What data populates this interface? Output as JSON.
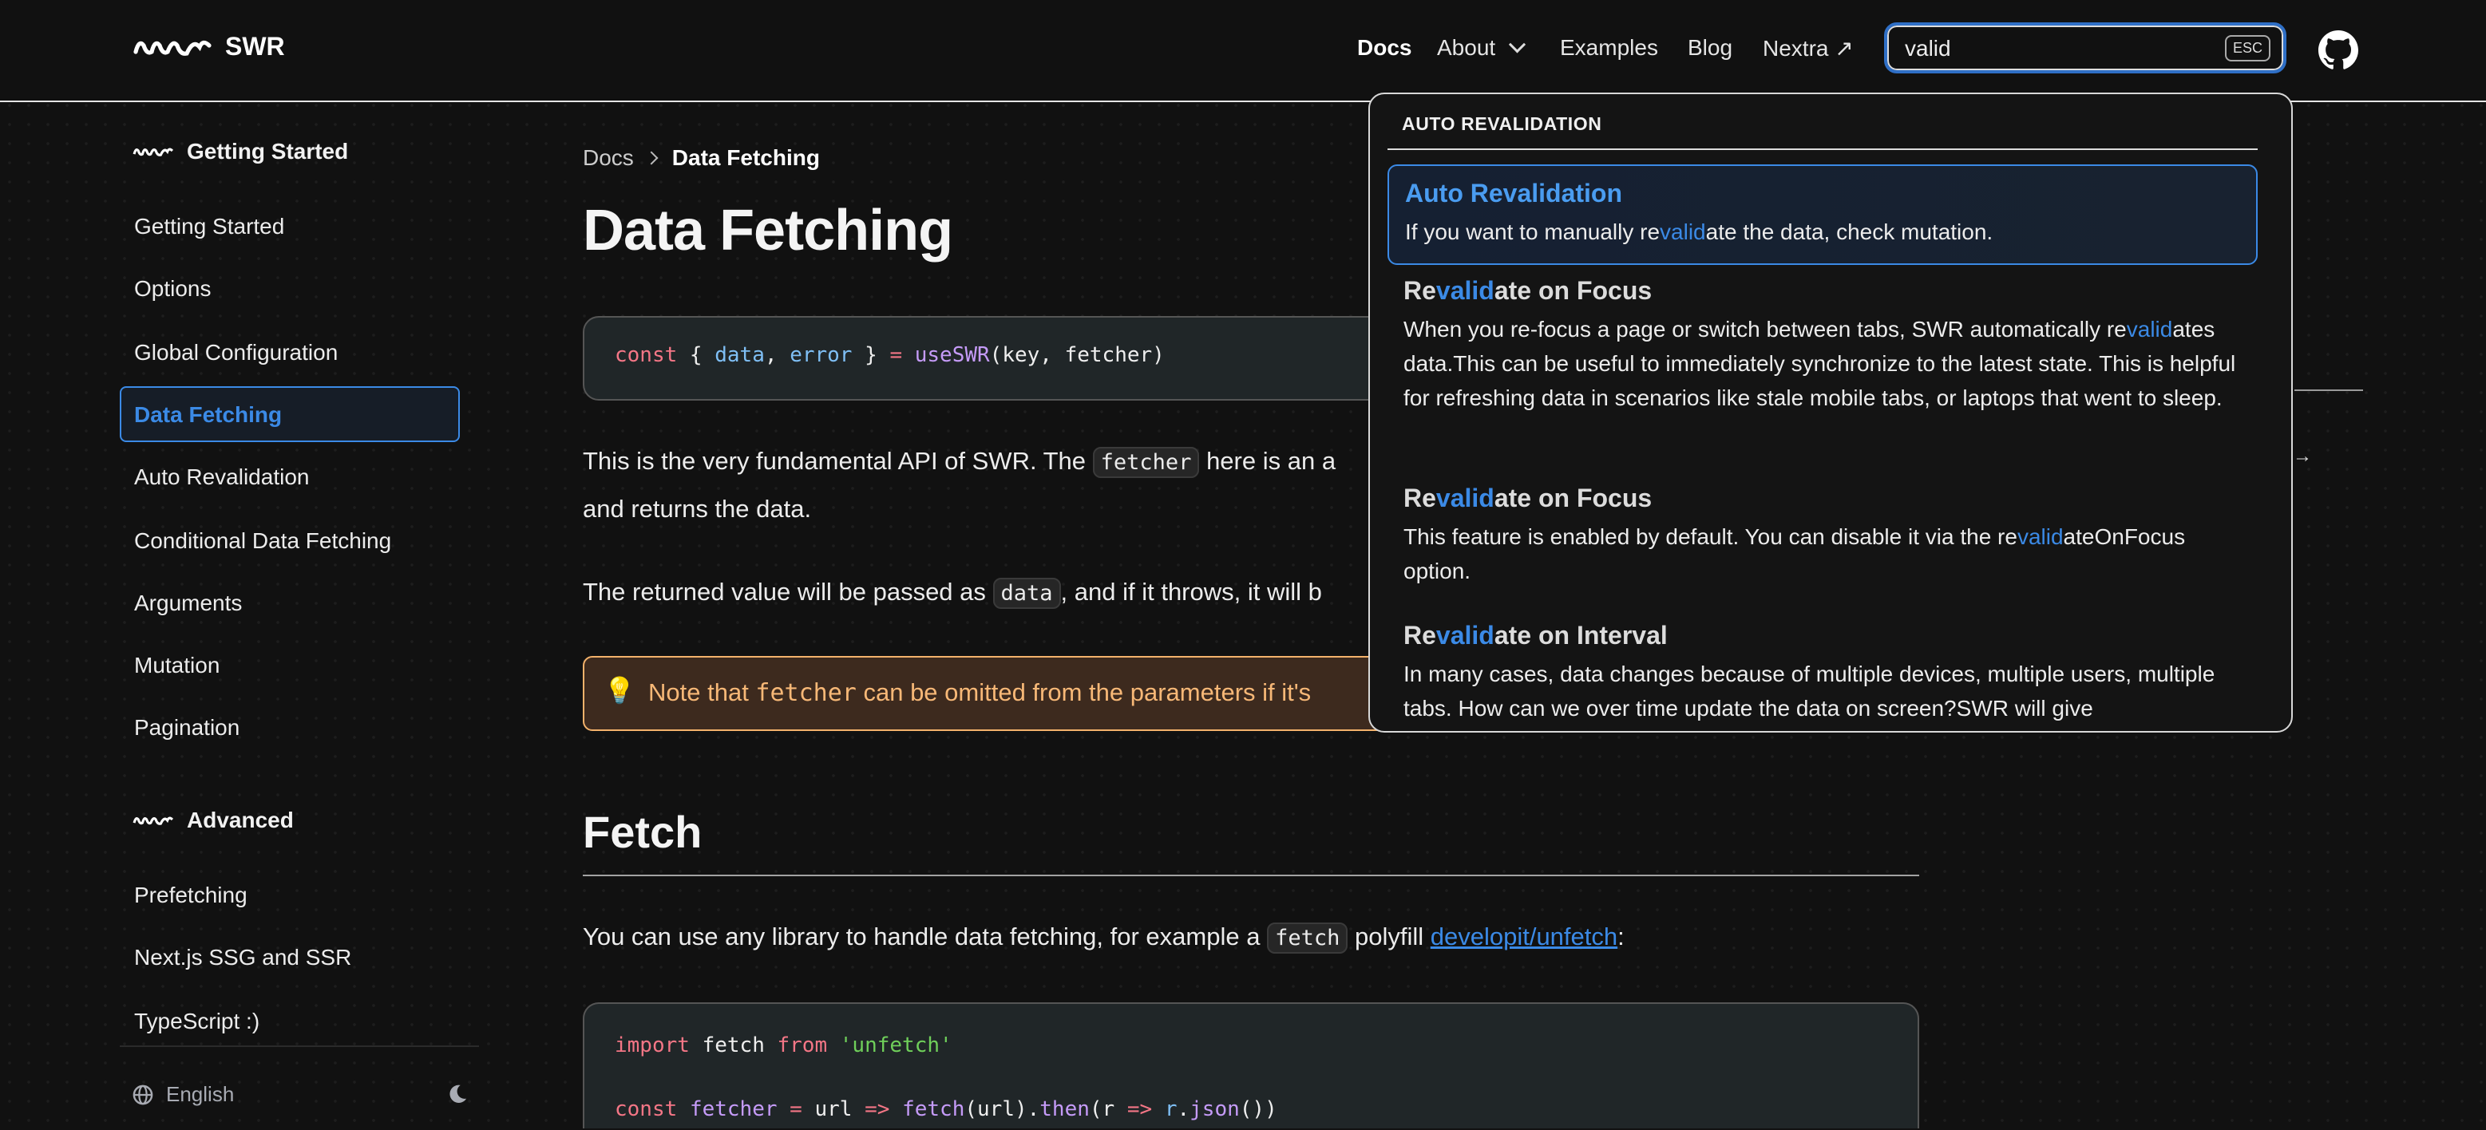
{
  "header": {
    "brand": "SWR",
    "nav": [
      {
        "label": "Docs",
        "active": true
      },
      {
        "label": "About",
        "has_dropdown": true
      },
      {
        "label": "Examples"
      },
      {
        "label": "Blog"
      },
      {
        "label": "Nextra ↗"
      }
    ],
    "search": {
      "value": "valid",
      "esc_label": "ESC",
      "focus_color": "#2f6fc6"
    }
  },
  "sidebar": {
    "sections": [
      {
        "title": "Getting Started",
        "items": [
          "Getting Started",
          "Options",
          "Global Configuration",
          "Data Fetching",
          "Auto Revalidation",
          "Conditional Data Fetching",
          "Arguments",
          "Mutation",
          "Pagination"
        ],
        "active": "Data Fetching"
      },
      {
        "title": "Advanced",
        "items": [
          "Prefetching",
          "Next.js SSG and SSR",
          "TypeScript :)"
        ]
      }
    ],
    "footer": {
      "language": "English",
      "theme_icon": "moon-icon"
    }
  },
  "main": {
    "breadcrumb": [
      "Docs",
      "Data Fetching"
    ],
    "title": "Data Fetching",
    "code1": [
      [
        "kw",
        "const"
      ],
      [
        "pl",
        " { "
      ],
      [
        "vr",
        "data"
      ],
      [
        "pl",
        ", "
      ],
      [
        "vr",
        "error"
      ],
      [
        "pl",
        " } "
      ],
      [
        "kw",
        "="
      ],
      [
        "pl",
        " "
      ],
      [
        "fn",
        "useSWR"
      ],
      [
        "pl",
        "(key, fetcher)"
      ]
    ],
    "para1": {
      "a": "This is the very fundamental API of SWR. The ",
      "code": "fetcher",
      "b": " here is an a",
      "line2": "and returns the data."
    },
    "para2": {
      "a": "The returned value will be passed as ",
      "code": "data",
      "b": ", and if it throws, it will b"
    },
    "callout": {
      "icon": "💡",
      "a": "Note that ",
      "code": "fetcher",
      "b": " can be omitted from the parameters if it's",
      "color": "#f7b877"
    },
    "h2": "Fetch",
    "para3": {
      "a": "You can use any library to handle data fetching, for example a ",
      "code": "fetch",
      "b": " polyfill ",
      "link": "developit/unfetch",
      "c": ":"
    },
    "code2": [
      [
        [
          "kw",
          "import"
        ],
        [
          "pl",
          " fetch "
        ],
        [
          "kw",
          "from"
        ],
        [
          "pl",
          " "
        ],
        [
          "st",
          "'unfetch'"
        ]
      ],
      [
        [
          "kw",
          "const"
        ],
        [
          "pl",
          " "
        ],
        [
          "fn",
          "fetcher"
        ],
        [
          "pl",
          " "
        ],
        [
          "kw",
          "="
        ],
        [
          "pl",
          " url "
        ],
        [
          "kw",
          "=>"
        ],
        [
          "pl",
          " "
        ],
        [
          "fn",
          "fetch"
        ],
        [
          "pl",
          "(url)."
        ],
        [
          "fn",
          "then"
        ],
        [
          "pl",
          "(r "
        ],
        [
          "kw",
          "=>"
        ],
        [
          "pl",
          " "
        ],
        [
          "vr",
          "r"
        ],
        [
          "pl",
          "."
        ],
        [
          "fn",
          "json"
        ],
        [
          "pl",
          "())"
        ]
      ]
    ]
  },
  "search_results": {
    "group": "AUTO REVALIDATION",
    "highlight_color": "#3b8ae6",
    "items": [
      {
        "title": [
          [
            "",
            "Auto Revalidation"
          ]
        ],
        "desc": [
          [
            "",
            "If you want to manually re"
          ],
          [
            "hl",
            "valid"
          ],
          [
            "",
            "ate the data, check mutation."
          ]
        ],
        "selected": true
      },
      {
        "title": [
          [
            "",
            "Re"
          ],
          [
            "hl",
            "valid"
          ],
          [
            "",
            "ate on Focus"
          ]
        ],
        "desc": [
          [
            "",
            "When you re-focus a page or switch between tabs, SWR automatically re"
          ],
          [
            "hl",
            "valid"
          ],
          [
            "",
            "ates data.This can be useful to immediately synchronize to the latest state. This is helpful for refreshing data in scenarios like stale mobile tabs, or laptops that went to sleep."
          ]
        ]
      },
      {
        "title": [
          [
            "",
            "Re"
          ],
          [
            "hl",
            "valid"
          ],
          [
            "",
            "ate on Focus"
          ]
        ],
        "desc": [
          [
            "",
            "This feature is enabled by default. You can disable it via the re"
          ],
          [
            "hl",
            "valid"
          ],
          [
            "",
            "ateOnFocus option."
          ]
        ]
      },
      {
        "title": [
          [
            "",
            "Re"
          ],
          [
            "hl",
            "valid"
          ],
          [
            "",
            "ate on Interval"
          ]
        ],
        "desc": [
          [
            "",
            "In many cases, data changes because of multiple devices, multiple users, multiple tabs. How can we over time update the data on screen?SWR will give"
          ]
        ]
      }
    ]
  }
}
